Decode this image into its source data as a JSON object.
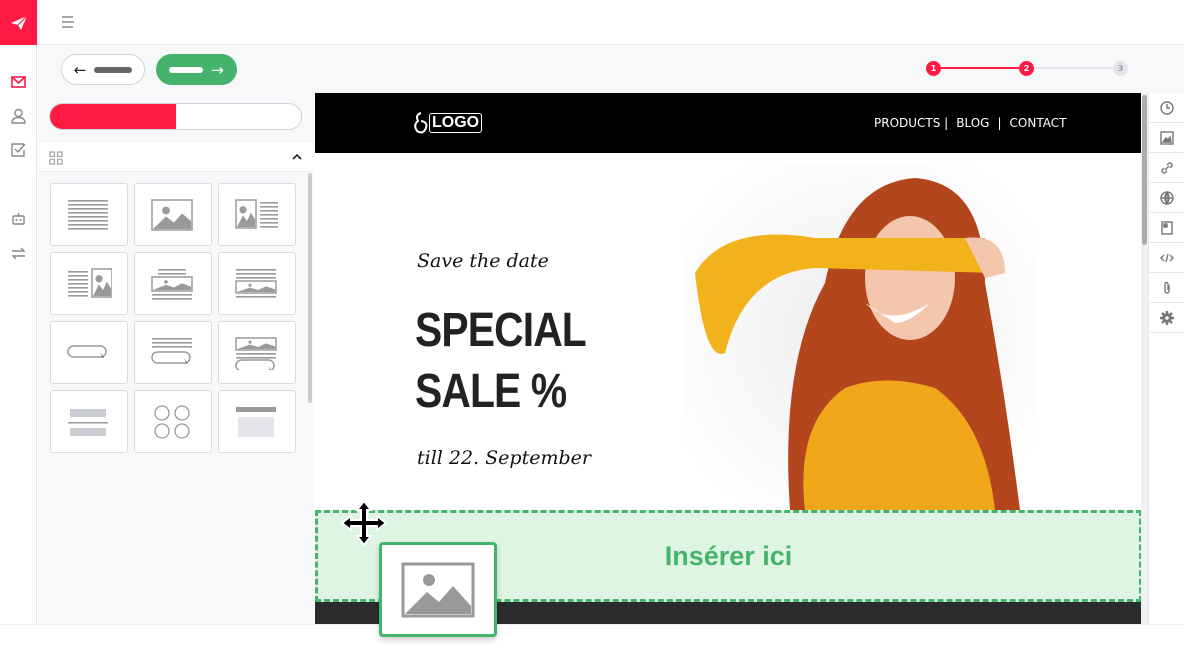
{
  "colors": {
    "brand": "#ff1a44",
    "green": "#45b36b",
    "drop_bg": "#dff5e3"
  },
  "stepper": {
    "steps": [
      "1",
      "2",
      "3"
    ],
    "current": 2
  },
  "progress": {
    "value_percent": 50
  },
  "email": {
    "logo_text": "LOGO",
    "nav": [
      "PRODUCTS |",
      "BLOG",
      "|",
      "CONTACT"
    ],
    "eyebrow": "Save the date",
    "headline_1": "SPECIAL",
    "headline_2": "SALE %",
    "date": "till 22. September"
  },
  "dropzone": {
    "label": "Insérer ici"
  },
  "icons": {
    "leftbar": [
      "mail-icon",
      "user-icon",
      "checklist-icon",
      "robot-icon",
      "swap-icon"
    ],
    "rightbar": [
      "clock-icon",
      "image-icon",
      "link-icon",
      "globe-icon",
      "document-icon",
      "code-icon",
      "attachment-icon",
      "gear-icon"
    ]
  },
  "blocks": [
    "text",
    "image",
    "image-text",
    "text-image",
    "image-caption",
    "text-image-caption",
    "button",
    "text-button",
    "image-text-button",
    "divider",
    "social",
    "spacer"
  ]
}
